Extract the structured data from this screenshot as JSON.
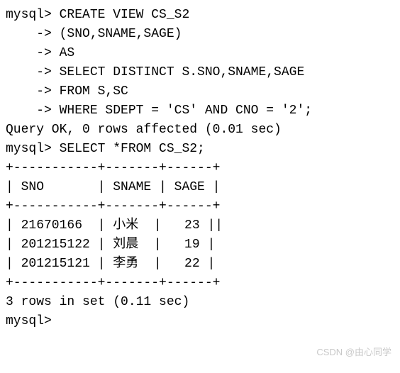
{
  "lines": {
    "l0": "mysql> CREATE VIEW CS_S2",
    "l1": "    -> (SNO,SNAME,SAGE)",
    "l2": "    -> AS",
    "l3": "    -> SELECT DISTINCT S.SNO,SNAME,SAGE",
    "l4": "    -> FROM S,SC",
    "l5": "    -> WHERE SDEPT = 'CS' AND CNO = '2';",
    "l6": "Query OK, 0 rows affected (0.01 sec)",
    "l7": "",
    "l8": "mysql> SELECT *FROM CS_S2;",
    "l9": "+-----------+-------+------+",
    "l10": "| SNO       | SNAME | SAGE |",
    "l11": "+-----------+-------+------+",
    "l12": "| 21670166  | 小米  |   23 ||",
    "l13": "| 201215122 | 刘晨  |   19 |",
    "l14": "| 201215121 | 李勇  |   22 |",
    "l15": "+-----------+-------+------+",
    "l16": "3 rows in set (0.11 sec)",
    "l17": "",
    "l18": "mysql>"
  },
  "chart_data": {
    "type": "table",
    "title": "CS_S2",
    "columns": [
      "SNO",
      "SNAME",
      "SAGE"
    ],
    "rows": [
      {
        "SNO": "21670166",
        "SNAME": "小米",
        "SAGE": 23
      },
      {
        "SNO": "201215122",
        "SNAME": "刘晨",
        "SAGE": 19
      },
      {
        "SNO": "201215121",
        "SNAME": "李勇",
        "SAGE": 22
      }
    ],
    "row_count": 3,
    "query_time_sec": 0.11,
    "create_view_time_sec": 0.01
  },
  "watermark": "CSDN @由心同学"
}
